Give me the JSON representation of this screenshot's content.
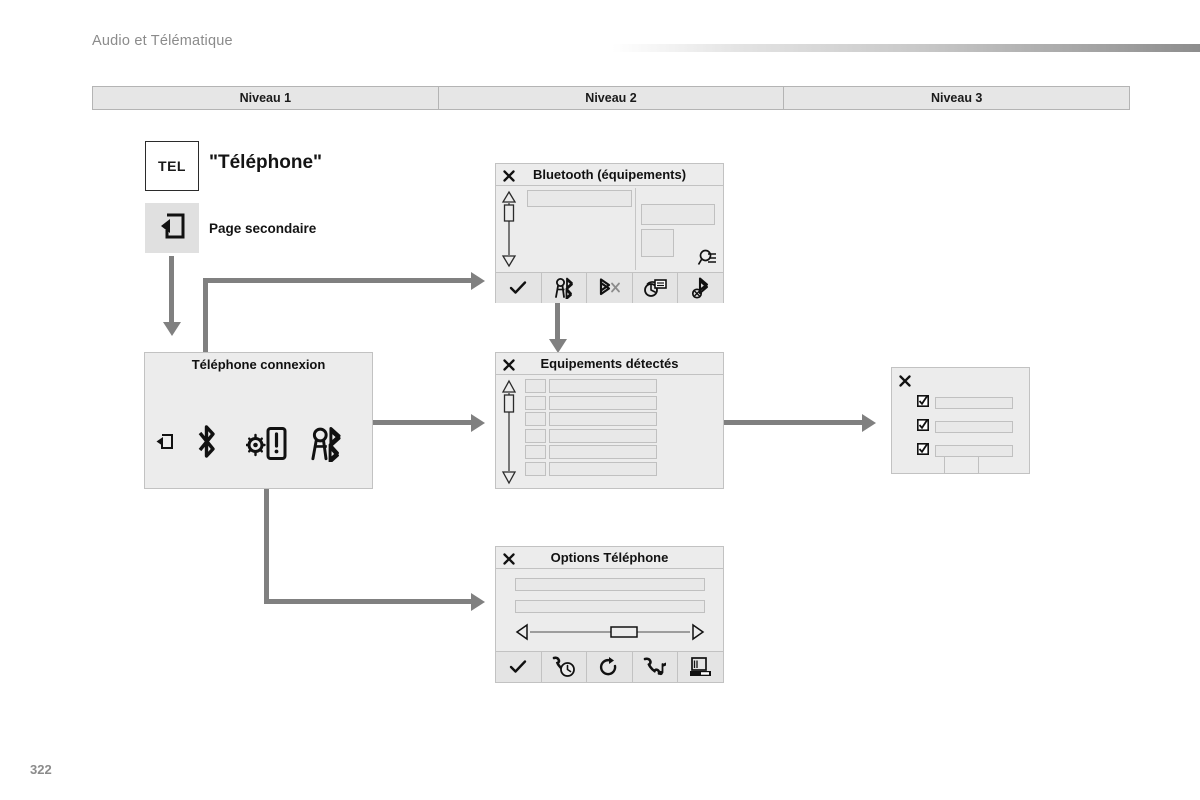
{
  "header": {
    "section_title": "Audio et Télématique",
    "page_number": "322"
  },
  "columns": [
    {
      "label": "Niveau 1"
    },
    {
      "label": "Niveau 2"
    },
    {
      "label": "Niveau 3"
    }
  ],
  "legend": {
    "menu_key": "TEL",
    "menu_label": "\"Téléphone\"",
    "secondary_icon": "page-secondaire-icon",
    "secondary_label": "Page secondaire"
  },
  "panels": {
    "bluetooth": {
      "title": "Bluetooth (équipements)",
      "close_icon": "close-icon",
      "search_icon": "magnifier-list-icon",
      "toolbar": [
        {
          "icon": "check-icon"
        },
        {
          "icon": "bluetooth-pair-icon"
        },
        {
          "icon": "bluetooth-disconnect-icon"
        },
        {
          "icon": "contact-card-icon"
        },
        {
          "icon": "bluetooth-remove-icon"
        }
      ]
    },
    "telephone_connexion": {
      "title": "Téléphone connexion",
      "icons": [
        {
          "icon": "page-secondaire-icon"
        },
        {
          "icon": "bluetooth-icon"
        },
        {
          "icon": "phone-settings-icon"
        },
        {
          "icon": "bluetooth-pair-icon"
        }
      ]
    },
    "equipements_detectes": {
      "title": "Equipements détectés",
      "close_icon": "close-icon",
      "row_count": 6
    },
    "niveau3": {
      "close_icon": "close-icon",
      "row_count": 3,
      "checkbox_icon": "checkbox-checked-icon"
    },
    "options_telephone": {
      "title": "Options Téléphone",
      "close_icon": "close-icon",
      "slider": {
        "left_icon": "triangle-left-icon",
        "right_icon": "triangle-right-icon"
      },
      "toolbar": [
        {
          "icon": "check-icon"
        },
        {
          "icon": "call-history-icon"
        },
        {
          "icon": "repeat-icon"
        },
        {
          "icon": "phone-music-icon"
        },
        {
          "icon": "answering-machine-icon"
        }
      ]
    }
  },
  "colors": {
    "connector": "#808080",
    "panel_bg": "#ececec",
    "panel_border": "#c2c2c2",
    "header_text": "#8b8b8b"
  }
}
